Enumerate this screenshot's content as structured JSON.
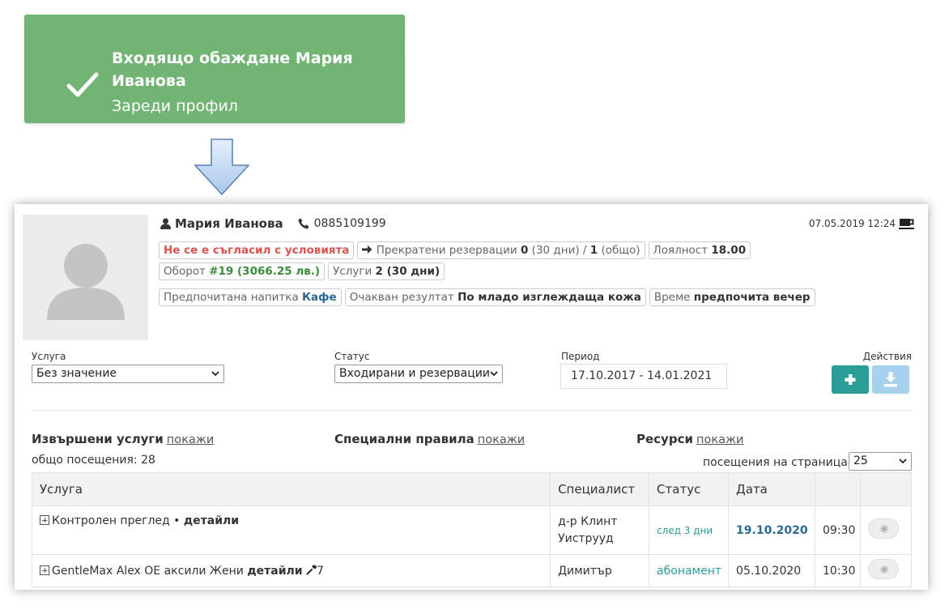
{
  "notification": {
    "title": "Входящо обаждане Мария Иванова",
    "subtitle": "Зареди профил",
    "close": "×",
    "color": "#72b474"
  },
  "client": {
    "name": "Мария Иванова",
    "phone": "0885109199",
    "timestamp": "07.05.2019 12:24",
    "badges_row1": {
      "terms": "Не се е съгласил с условията",
      "cancelled_label": "Прекратени резервации",
      "cancelled_30": "0",
      "cancelled_30_suffix": "(30 дни) /",
      "cancelled_total": "1",
      "cancelled_total_suffix": "(общо)",
      "loyalty_label": "Лоялност",
      "loyalty_value": "18.00",
      "turnover_label": "Оборот",
      "turnover_value": "#19 (3066.25 лв.)",
      "services_label": "Услуги",
      "services_value": "2 (30 дни)"
    },
    "badges_row2": {
      "drink_label": "Предпочитана напитка",
      "drink_value": "Кафе",
      "result_label": "Очакван резултат",
      "result_value": "По младо изглеждаща кожа",
      "time_label": "Време",
      "time_value": "предпочита вечер"
    }
  },
  "filters": {
    "service_label": "Услуга",
    "service_value": "Без значение",
    "status_label": "Статус",
    "status_value": "Входирани и резервации",
    "period_label": "Период",
    "period_value": "17.10.2017 - 14.01.2021",
    "actions_label": "Действия"
  },
  "sections": {
    "services": "Извършени услуги",
    "rules": "Специални правила",
    "resources": "Ресурси",
    "show": "покажи",
    "total_visits": "общо посещения: 28",
    "per_page_label": "посещения на страница:",
    "per_page_value": "25"
  },
  "table": {
    "headers": [
      "Услуга",
      "Специалист",
      "Статус",
      "Дата",
      "",
      ""
    ],
    "rows": [
      {
        "service": "Контролен преглед •",
        "details": "детайли",
        "extra": "",
        "specialist": "д-р Клинт Уиструуд",
        "status": "след 3 дни",
        "date": "19.10.2020",
        "time": "09:30"
      },
      {
        "service": "GentleMax Alex OE аксили Жени",
        "details": "детайли",
        "extra": "7",
        "specialist": "Димитър",
        "status": "абонамент",
        "date": "05.10.2020",
        "time": "10:30"
      }
    ]
  },
  "colors": {
    "accent": "#2a9d96",
    "danger": "#d9534f",
    "success": "#3c8a3c",
    "link_blue": "#2b6a92"
  }
}
